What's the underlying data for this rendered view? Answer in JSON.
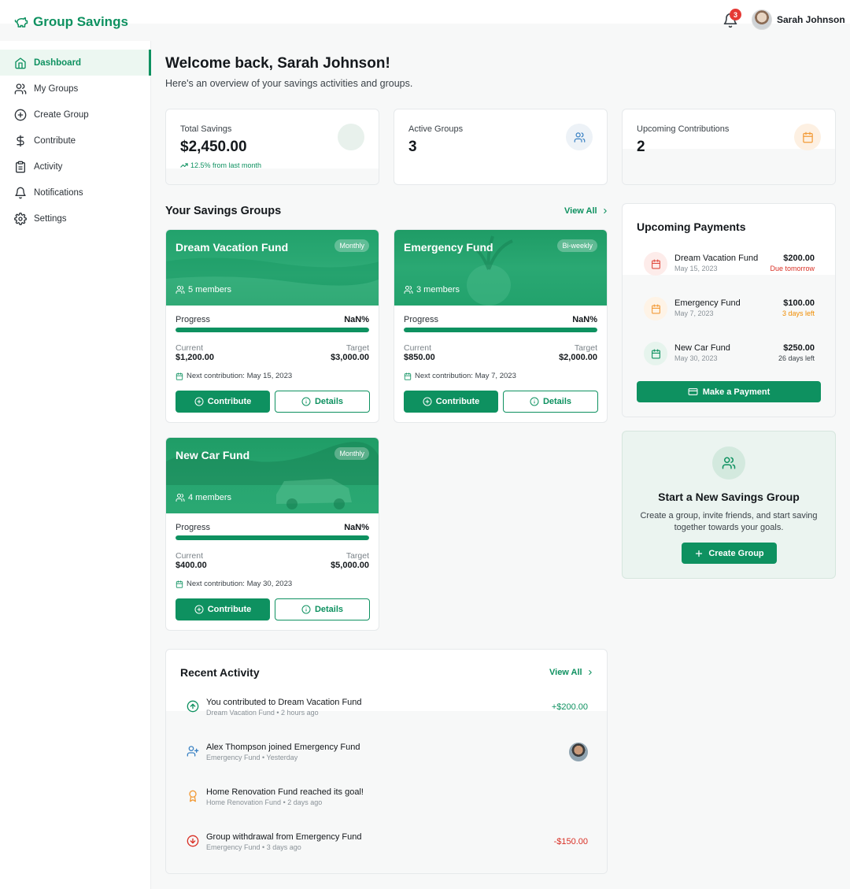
{
  "app": {
    "title": "Group Savings",
    "notifications_count": "3",
    "user_name": "Sarah Johnson"
  },
  "sidebar": {
    "items": [
      {
        "label": "Dashboard",
        "icon": "home-icon",
        "active": true
      },
      {
        "label": "My Groups",
        "icon": "users-icon"
      },
      {
        "label": "Create Group",
        "icon": "plus-circle-icon"
      },
      {
        "label": "Contribute",
        "icon": "dollar-icon"
      },
      {
        "label": "Activity",
        "icon": "clipboard-icon"
      },
      {
        "label": "Notifications",
        "icon": "bell-icon"
      },
      {
        "label": "Settings",
        "icon": "gear-icon"
      }
    ]
  },
  "page": {
    "title": "Welcome back, Sarah Johnson!",
    "subtitle": "Here's an overview of your savings activities and groups."
  },
  "stats": {
    "total_savings": {
      "label": "Total Savings",
      "value": "$2,450.00",
      "trend": "12.5% from last month"
    },
    "active_groups": {
      "label": "Active Groups",
      "value": "3"
    },
    "upcoming": {
      "label": "Upcoming Contributions",
      "value": "2"
    }
  },
  "groups_section": {
    "title": "Your Savings Groups",
    "view_all": "View All"
  },
  "groups": [
    {
      "name": "Dream Vacation Fund",
      "frequency": "Monthly",
      "members": "5 members",
      "progress_label": "Progress",
      "progress_text": "NaN%",
      "progress_fraction": 1.0,
      "current_label": "Current",
      "current": "$1,200.00",
      "target_label": "Target",
      "target": "$3,000.00",
      "next": "Next contribution: May 15, 2023",
      "contribute": "Contribute",
      "details": "Details"
    },
    {
      "name": "Emergency Fund",
      "frequency": "Bi-weekly",
      "members": "3 members",
      "progress_label": "Progress",
      "progress_text": "NaN%",
      "progress_fraction": 1.0,
      "current_label": "Current",
      "current": "$850.00",
      "target_label": "Target",
      "target": "$2,000.00",
      "next": "Next contribution: May 7, 2023",
      "contribute": "Contribute",
      "details": "Details"
    },
    {
      "name": "New Car Fund",
      "frequency": "Monthly",
      "members": "4 members",
      "progress_label": "Progress",
      "progress_text": "NaN%",
      "progress_fraction": 1.0,
      "current_label": "Current",
      "current": "$400.00",
      "target_label": "Target",
      "target": "$5,000.00",
      "next": "Next contribution: May 30, 2023",
      "contribute": "Contribute",
      "details": "Details"
    }
  ],
  "payments": {
    "title": "Upcoming Payments",
    "items": [
      {
        "name": "Dream Vacation Fund",
        "date": "May 15, 2023",
        "amount": "$200.00",
        "due": "Due tomorrow",
        "due_color": "#d93025",
        "icon_color": "#e04b3f",
        "icon_bg": "#fdecea"
      },
      {
        "name": "Emergency Fund",
        "date": "May 7, 2023",
        "amount": "$100.00",
        "due": "3 days left",
        "due_color": "#f08c00",
        "icon_color": "#f29b38",
        "icon_bg": "#fef3e6"
      },
      {
        "name": "New Car Fund",
        "date": "May 30, 2023",
        "amount": "$250.00",
        "due": "26 days left",
        "due_color": "#3b4248",
        "icon_color": "#0e9160",
        "icon_bg": "#e6f4ed"
      }
    ],
    "button": "Make a Payment"
  },
  "new_group": {
    "title": "Start a New Savings Group",
    "description": "Create a group, invite friends, and start saving together towards your goals.",
    "button": "Create Group"
  },
  "activity": {
    "title": "Recent Activity",
    "view_all": "View All",
    "items": [
      {
        "title": "You contributed to Dream Vacation Fund",
        "group": "Dream Vacation Fund",
        "time": "2 hours ago",
        "amount": "+$200.00",
        "amount_color": "#0e9160",
        "icon": "arrow-up-circle-icon"
      },
      {
        "title": "Alex Thompson joined Emergency Fund",
        "group": "Emergency Fund",
        "time": "Yesterday",
        "amount": "",
        "icon": "user-plus-icon"
      },
      {
        "title": "Home Renovation Fund reached its goal!",
        "group": "Home Renovation Fund",
        "time": "2 days ago",
        "amount": "",
        "icon": "award-icon"
      },
      {
        "title": "Group withdrawal from Emergency Fund",
        "group": "Emergency Fund",
        "time": "3 days ago",
        "amount": "-$150.00",
        "amount_color": "#d93025",
        "icon": "arrow-down-circle-icon"
      }
    ]
  },
  "colors": {
    "brand": "#0e9160",
    "danger": "#d93025",
    "warning": "#f08c00"
  }
}
